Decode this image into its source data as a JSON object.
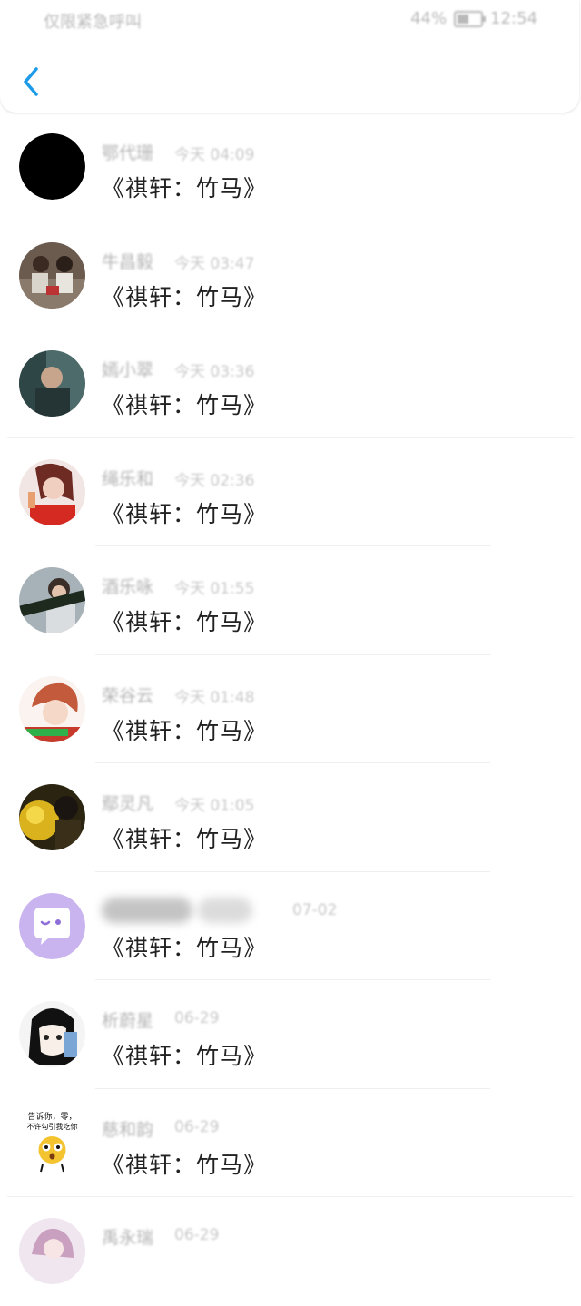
{
  "status_bar": {
    "carrier": "仅限紧急呼叫",
    "battery": "44%",
    "time": "12:54"
  },
  "colors": {
    "accent": "#1e9be8",
    "message_text": "#222222",
    "meta_text": "#b3b3b3"
  },
  "items": [
    {
      "name": "鄂代珊",
      "time": "今天 04:09",
      "message": "《祺轩：竹马》"
    },
    {
      "name": "牛昌毅",
      "time": "今天 03:47",
      "message": "《祺轩：竹马》"
    },
    {
      "name": "嫣小翠",
      "time": "今天 03:36",
      "message": "《祺轩：竹马》"
    },
    {
      "name": "绳乐和",
      "time": "今天 02:36",
      "message": "《祺轩：竹马》"
    },
    {
      "name": "酒乐咏",
      "time": "今天 01:55",
      "message": "《祺轩：竹马》"
    },
    {
      "name": "荣谷云",
      "time": "今天 01:48",
      "message": "《祺轩：竹马》"
    },
    {
      "name": "鄢灵凡",
      "time": "今天 01:05",
      "message": "《祺轩：竹马》"
    },
    {
      "name": "",
      "time": "07-02",
      "message": "《祺轩：竹马》"
    },
    {
      "name": "析蔚星",
      "time": "06-29",
      "message": "《祺轩：竹马》"
    },
    {
      "name": "慈和韵",
      "time": "06-29",
      "message": "《祺轩：竹马》"
    },
    {
      "name": "禹永瑞",
      "time": "06-29",
      "message": ""
    }
  ],
  "avatar_captions": {
    "item_10_line1": "告诉你，零，",
    "item_10_line2": "不许勾引我吃你"
  }
}
